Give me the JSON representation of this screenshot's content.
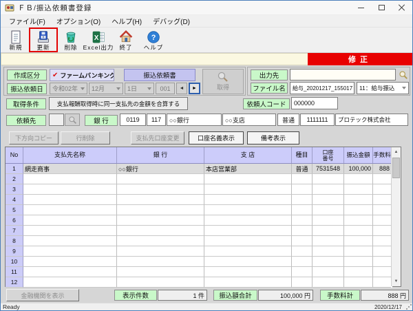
{
  "window": {
    "title": "ＦＢ/振込依頼書登録"
  },
  "menu": {
    "items": [
      "ファイル(F)",
      "オプション(O)",
      "ヘルプ(H)",
      "デバッグ(D)"
    ]
  },
  "toolbar": {
    "buttons": [
      {
        "label": "新規",
        "icon": "new-document-icon"
      },
      {
        "label": "更新",
        "icon": "save-update-icon",
        "highlighted": true
      },
      {
        "label": "削除",
        "icon": "recycle-bin-icon"
      },
      {
        "label": "Excel出力",
        "icon": "excel-icon"
      },
      {
        "label": "終了",
        "icon": "exit-house-icon"
      },
      {
        "label": "ヘルプ",
        "icon": "help-icon"
      }
    ]
  },
  "mode": {
    "label": "修正",
    "color": "#e80000"
  },
  "form": {
    "creation": {
      "label": "作成区分",
      "check_icon": "✔",
      "check_label": "ファームバンキング",
      "doc_button": "振込依頼書"
    },
    "request_date": {
      "label": "振込依頼日",
      "year": "令和02年",
      "month": "12月",
      "day": "1日",
      "seq": "001",
      "prev_icon": "◄",
      "next_icon": "►"
    },
    "get_button": {
      "label": "取得"
    },
    "output": {
      "label": "出力先",
      "value": ""
    },
    "file": {
      "label": "ファイル名",
      "value": "給与_20201217_155017",
      "type_select": "11：給与振込"
    },
    "condition": {
      "label": "取得条件",
      "button": "支払報酬取得時に同一支払先の金額を合算する"
    },
    "client_code": {
      "label": "依頼人コード",
      "value": "000000"
    },
    "requester": {
      "label": "依頼先",
      "lookup_value": "",
      "bank_label": "銀 行",
      "bank_code": "0119",
      "branch_code": "117",
      "bank_name": "○○銀行",
      "branch_name": "○○支店",
      "account_type": "普通",
      "account_number": "1111111",
      "company": "プロテック株式会社"
    }
  },
  "actions": {
    "buttons": [
      {
        "label": "下方向コピー",
        "enabled": false
      },
      {
        "label": "行削除",
        "enabled": false
      },
      {
        "label": "支払先口座変更",
        "enabled": false
      },
      {
        "label": "口座名義表示",
        "enabled": true
      },
      {
        "label": "備考表示",
        "enabled": true
      }
    ]
  },
  "table": {
    "headers": [
      "No",
      "支払先名称",
      "銀 行",
      "支 店",
      "種目",
      "口座\n番号",
      "振込金額",
      "手数料"
    ],
    "scroll_up_icon": "▲",
    "scroll_down_icon": "▼",
    "rows": [
      {
        "no": "1",
        "name": "網走商事",
        "bank": "○○銀行",
        "branch": "本店営業部",
        "type": "普通",
        "account": "7531548",
        "amount": "100,000",
        "fee": "888",
        "selected": true
      },
      {
        "no": "2",
        "name": "",
        "bank": "",
        "branch": "",
        "type": "",
        "account": "",
        "amount": "",
        "fee": "",
        "selected": false
      },
      {
        "no": "3",
        "name": "",
        "bank": "",
        "branch": "",
        "type": "",
        "account": "",
        "amount": "",
        "fee": "",
        "selected": false
      },
      {
        "no": "4",
        "name": "",
        "bank": "",
        "branch": "",
        "type": "",
        "account": "",
        "amount": "",
        "fee": "",
        "selected": false
      },
      {
        "no": "5",
        "name": "",
        "bank": "",
        "branch": "",
        "type": "",
        "account": "",
        "amount": "",
        "fee": "",
        "selected": false
      },
      {
        "no": "6",
        "name": "",
        "bank": "",
        "branch": "",
        "type": "",
        "account": "",
        "amount": "",
        "fee": "",
        "selected": false
      },
      {
        "no": "7",
        "name": "",
        "bank": "",
        "branch": "",
        "type": "",
        "account": "",
        "amount": "",
        "fee": "",
        "selected": false
      },
      {
        "no": "8",
        "name": "",
        "bank": "",
        "branch": "",
        "type": "",
        "account": "",
        "amount": "",
        "fee": "",
        "selected": false
      },
      {
        "no": "9",
        "name": "",
        "bank": "",
        "branch": "",
        "type": "",
        "account": "",
        "amount": "",
        "fee": "",
        "selected": false
      },
      {
        "no": "10",
        "name": "",
        "bank": "",
        "branch": "",
        "type": "",
        "account": "",
        "amount": "",
        "fee": "",
        "selected": false
      },
      {
        "no": "11",
        "name": "",
        "bank": "",
        "branch": "",
        "type": "",
        "account": "",
        "amount": "",
        "fee": "",
        "selected": false
      },
      {
        "no": "12",
        "name": "",
        "bank": "",
        "branch": "",
        "type": "",
        "account": "",
        "amount": "",
        "fee": "",
        "selected": false
      }
    ]
  },
  "summary": {
    "bank_button": "金融機関を表示",
    "count_label": "表示件数",
    "count_value": "1 件",
    "total_label": "振込額合計",
    "total_value": "100,000 円",
    "fee_label": "手数料計",
    "fee_value": "888 円"
  },
  "statusbar": {
    "left": "Ready",
    "right": "2020/12/17"
  }
}
